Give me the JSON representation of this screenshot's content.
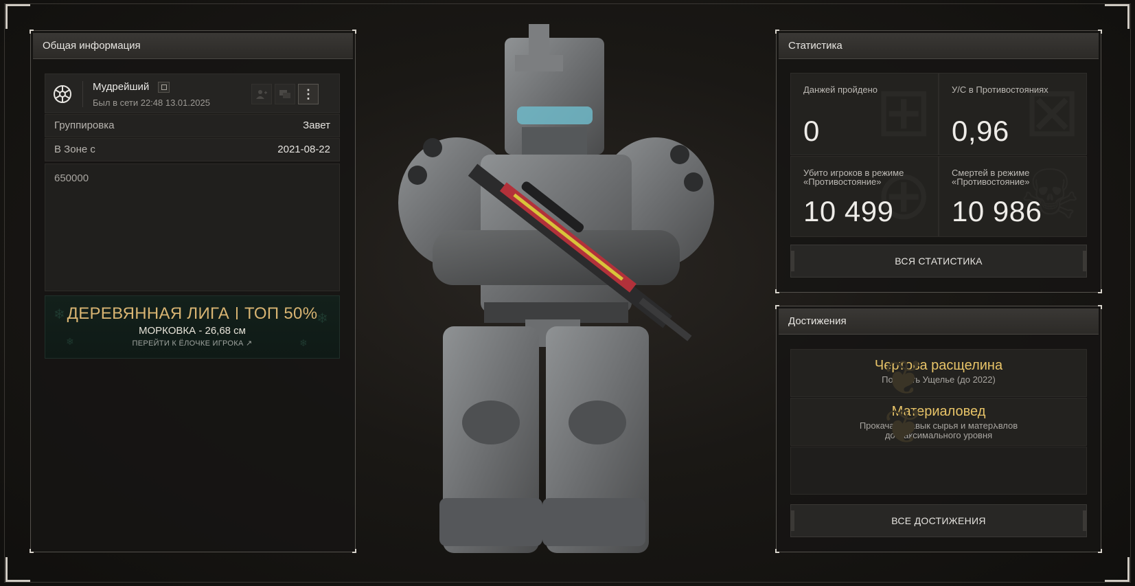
{
  "general": {
    "header": "Общая информация",
    "username": "Мудрейший",
    "last_online": "Был в сети 22:48 13.01.2025",
    "rows": [
      {
        "label": "Группировка",
        "value": "Завет"
      },
      {
        "label": "В Зоне с",
        "value": "2021-08-22"
      }
    ],
    "bio": "650000",
    "league": {
      "title_left": "ДЕРЕВЯННАЯ ЛИГА",
      "title_right": "ТОП 50%",
      "subtitle": "МОРКОВКА - 26,68 см",
      "link": "ПЕРЕЙТИ К ЁЛОЧКЕ ИГРОКА"
    },
    "icons": [
      "clan-emblem-icon",
      "copy-icon",
      "add-friend-icon",
      "chat-icon",
      "more-vertical-icon"
    ]
  },
  "stats": {
    "header": "Статистика",
    "cells": [
      {
        "label": "Данжей пройдено",
        "value": "0"
      },
      {
        "label": "У/С в Противостояниях",
        "value": "0,96"
      },
      {
        "label": "Убито игроков в режиме «Противостояние»",
        "value": "10 499"
      },
      {
        "label": "Смертей в режиме «Противостояние»",
        "value": "10 986"
      }
    ],
    "button": "ВСЯ СТАТИСТИКА"
  },
  "achievements": {
    "header": "Достижения",
    "items": [
      {
        "title": "Чертова расщелина",
        "desc": "Посетить Ущелье (до 2022)"
      },
      {
        "title": "Материаловед",
        "desc": "Прокачать навык сырья и матерአвлов до максимального уровня"
      }
    ],
    "button": "ВСЕ ДОСТИЖЕНИЯ"
  },
  "colors": {
    "accent_gold": "#e8c468",
    "league_gold": "#d8b472"
  }
}
